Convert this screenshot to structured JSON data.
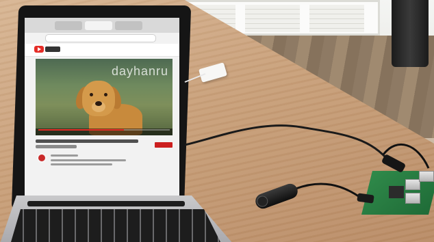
{
  "scene": {
    "description_free": true
  },
  "video": {
    "watermark": "dayhanru",
    "progress": 0.65,
    "accent_color": "#e52d27"
  },
  "colors": {
    "desk": "#c9a07a",
    "laptop_lid": "#151515",
    "pi_board": "#2f8a4a",
    "cable": "#1a1a1a"
  },
  "icons": {
    "youtube_logo": "youtube-logo-icon",
    "play": "play-icon"
  }
}
